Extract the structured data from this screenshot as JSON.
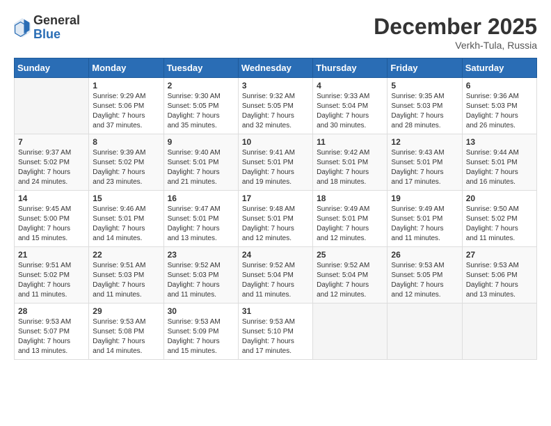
{
  "header": {
    "logo_general": "General",
    "logo_blue": "Blue",
    "month_title": "December 2025",
    "location": "Verkh-Tula, Russia"
  },
  "days_of_week": [
    "Sunday",
    "Monday",
    "Tuesday",
    "Wednesday",
    "Thursday",
    "Friday",
    "Saturday"
  ],
  "weeks": [
    [
      {
        "day": "",
        "info": ""
      },
      {
        "day": "1",
        "info": "Sunrise: 9:29 AM\nSunset: 5:06 PM\nDaylight: 7 hours\nand 37 minutes."
      },
      {
        "day": "2",
        "info": "Sunrise: 9:30 AM\nSunset: 5:05 PM\nDaylight: 7 hours\nand 35 minutes."
      },
      {
        "day": "3",
        "info": "Sunrise: 9:32 AM\nSunset: 5:05 PM\nDaylight: 7 hours\nand 32 minutes."
      },
      {
        "day": "4",
        "info": "Sunrise: 9:33 AM\nSunset: 5:04 PM\nDaylight: 7 hours\nand 30 minutes."
      },
      {
        "day": "5",
        "info": "Sunrise: 9:35 AM\nSunset: 5:03 PM\nDaylight: 7 hours\nand 28 minutes."
      },
      {
        "day": "6",
        "info": "Sunrise: 9:36 AM\nSunset: 5:03 PM\nDaylight: 7 hours\nand 26 minutes."
      }
    ],
    [
      {
        "day": "7",
        "info": "Sunrise: 9:37 AM\nSunset: 5:02 PM\nDaylight: 7 hours\nand 24 minutes."
      },
      {
        "day": "8",
        "info": "Sunrise: 9:39 AM\nSunset: 5:02 PM\nDaylight: 7 hours\nand 23 minutes."
      },
      {
        "day": "9",
        "info": "Sunrise: 9:40 AM\nSunset: 5:01 PM\nDaylight: 7 hours\nand 21 minutes."
      },
      {
        "day": "10",
        "info": "Sunrise: 9:41 AM\nSunset: 5:01 PM\nDaylight: 7 hours\nand 19 minutes."
      },
      {
        "day": "11",
        "info": "Sunrise: 9:42 AM\nSunset: 5:01 PM\nDaylight: 7 hours\nand 18 minutes."
      },
      {
        "day": "12",
        "info": "Sunrise: 9:43 AM\nSunset: 5:01 PM\nDaylight: 7 hours\nand 17 minutes."
      },
      {
        "day": "13",
        "info": "Sunrise: 9:44 AM\nSunset: 5:01 PM\nDaylight: 7 hours\nand 16 minutes."
      }
    ],
    [
      {
        "day": "14",
        "info": "Sunrise: 9:45 AM\nSunset: 5:00 PM\nDaylight: 7 hours\nand 15 minutes."
      },
      {
        "day": "15",
        "info": "Sunrise: 9:46 AM\nSunset: 5:01 PM\nDaylight: 7 hours\nand 14 minutes."
      },
      {
        "day": "16",
        "info": "Sunrise: 9:47 AM\nSunset: 5:01 PM\nDaylight: 7 hours\nand 13 minutes."
      },
      {
        "day": "17",
        "info": "Sunrise: 9:48 AM\nSunset: 5:01 PM\nDaylight: 7 hours\nand 12 minutes."
      },
      {
        "day": "18",
        "info": "Sunrise: 9:49 AM\nSunset: 5:01 PM\nDaylight: 7 hours\nand 12 minutes."
      },
      {
        "day": "19",
        "info": "Sunrise: 9:49 AM\nSunset: 5:01 PM\nDaylight: 7 hours\nand 11 minutes."
      },
      {
        "day": "20",
        "info": "Sunrise: 9:50 AM\nSunset: 5:02 PM\nDaylight: 7 hours\nand 11 minutes."
      }
    ],
    [
      {
        "day": "21",
        "info": "Sunrise: 9:51 AM\nSunset: 5:02 PM\nDaylight: 7 hours\nand 11 minutes."
      },
      {
        "day": "22",
        "info": "Sunrise: 9:51 AM\nSunset: 5:03 PM\nDaylight: 7 hours\nand 11 minutes."
      },
      {
        "day": "23",
        "info": "Sunrise: 9:52 AM\nSunset: 5:03 PM\nDaylight: 7 hours\nand 11 minutes."
      },
      {
        "day": "24",
        "info": "Sunrise: 9:52 AM\nSunset: 5:04 PM\nDaylight: 7 hours\nand 11 minutes."
      },
      {
        "day": "25",
        "info": "Sunrise: 9:52 AM\nSunset: 5:04 PM\nDaylight: 7 hours\nand 12 minutes."
      },
      {
        "day": "26",
        "info": "Sunrise: 9:53 AM\nSunset: 5:05 PM\nDaylight: 7 hours\nand 12 minutes."
      },
      {
        "day": "27",
        "info": "Sunrise: 9:53 AM\nSunset: 5:06 PM\nDaylight: 7 hours\nand 13 minutes."
      }
    ],
    [
      {
        "day": "28",
        "info": "Sunrise: 9:53 AM\nSunset: 5:07 PM\nDaylight: 7 hours\nand 13 minutes."
      },
      {
        "day": "29",
        "info": "Sunrise: 9:53 AM\nSunset: 5:08 PM\nDaylight: 7 hours\nand 14 minutes."
      },
      {
        "day": "30",
        "info": "Sunrise: 9:53 AM\nSunset: 5:09 PM\nDaylight: 7 hours\nand 15 minutes."
      },
      {
        "day": "31",
        "info": "Sunrise: 9:53 AM\nSunset: 5:10 PM\nDaylight: 7 hours\nand 17 minutes."
      },
      {
        "day": "",
        "info": ""
      },
      {
        "day": "",
        "info": ""
      },
      {
        "day": "",
        "info": ""
      }
    ]
  ]
}
